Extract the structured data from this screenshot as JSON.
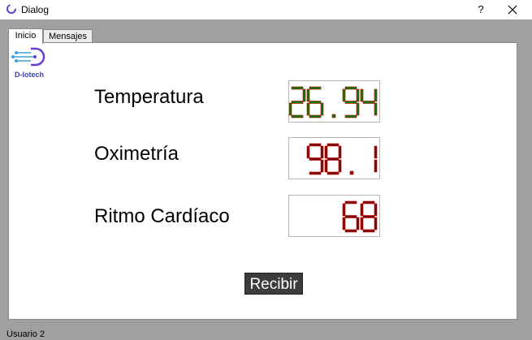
{
  "window": {
    "title": "Dialog",
    "help_label": "?"
  },
  "tabs": [
    {
      "label": "Inicio"
    },
    {
      "label": "Mensajes"
    }
  ],
  "logo": {
    "text": "D-Iotech"
  },
  "readings": [
    {
      "label": "Temperatura",
      "value": "26.94",
      "color": "#0a7a0a"
    },
    {
      "label": "Oximetría",
      "value": "98.1",
      "color": "#7a0a0a"
    },
    {
      "label": "Ritmo Cardíaco",
      "value": "68",
      "color": "#7a0a0a"
    }
  ],
  "actions": {
    "receive_label": "Recibir"
  },
  "status": {
    "user": "Usuario 2"
  }
}
